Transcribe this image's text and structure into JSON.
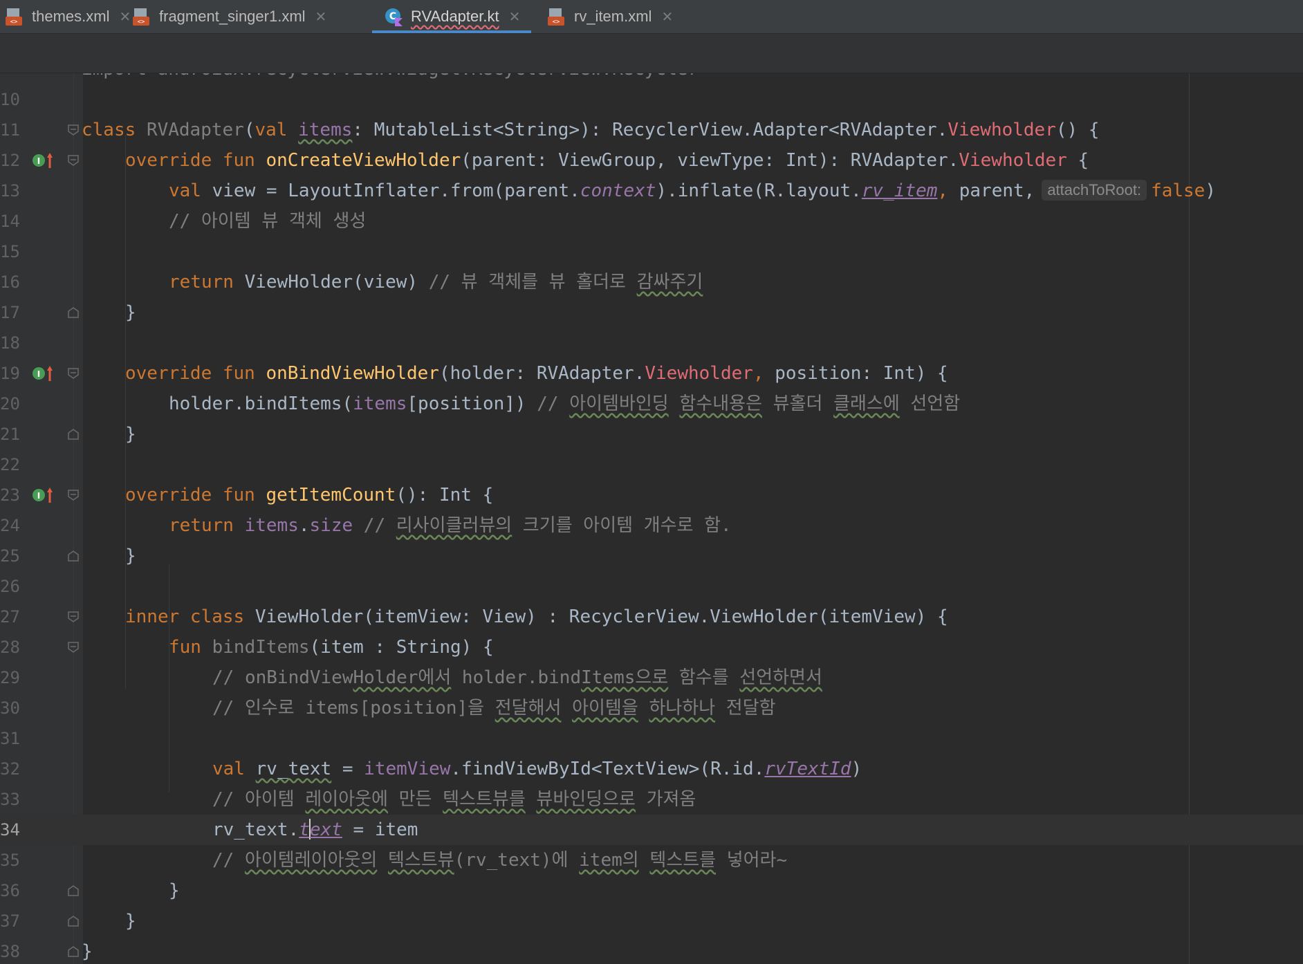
{
  "tabs": [
    {
      "label": "themes.xml",
      "icon": "xml-file-icon",
      "active": false
    },
    {
      "label": "fragment_singer1.xml",
      "icon": "xml-file-icon",
      "active": false
    },
    {
      "label": "RVAdapter.kt",
      "icon": "kotlin-class-icon",
      "active": true
    },
    {
      "label": "rv_item.xml",
      "icon": "xml-file-icon",
      "active": false
    }
  ],
  "editor": {
    "current_line": "34",
    "partial_top_line": "import androidx.recyclerview.widget.RecyclerView.Recycler",
    "line_numbers": [
      "10",
      "11",
      "12",
      "13",
      "14",
      "15",
      "16",
      "17",
      "18",
      "19",
      "20",
      "21",
      "22",
      "23",
      "24",
      "25",
      "26",
      "27",
      "28",
      "29",
      "30",
      "31",
      "32",
      "33",
      "34",
      "35",
      "36",
      "37",
      "38"
    ],
    "lines": {
      "l11": {
        "kw_class": "class",
        "name": "RVAdapter",
        "p1": "(",
        "kw_val": "val",
        "items": "items",
        "sig": ": MutableList<String>): RecyclerView.Adapter<RVAdapter.",
        "vh": "Viewholder",
        "end": "() {"
      },
      "l12": {
        "kw": "override fun",
        "fn": "onCreateViewHolder",
        "rest": "(parent: ViewGroup, viewType: Int): RVAdapter.",
        "vh": "Viewholder",
        "end": " {"
      },
      "l13": {
        "kw": "val",
        "a": " view = LayoutInflater.from(parent.",
        "ctx": "context",
        "b": ").inflate(R.layout.",
        "rv": "rv_item",
        "comma": ",",
        "c": " parent,",
        "hint": "attachToRoot:",
        "false": "false",
        "end": ")"
      },
      "l14": {
        "text": "// 아이템 뷰 객체 생성"
      },
      "l16": {
        "kw": "return",
        "code": " ViewHolder(view) ",
        "c1": "// 뷰 객체를 뷰 홀더로 ",
        "c2": "감싸주기"
      },
      "l17": {
        "text": "}"
      },
      "l19": {
        "kw": "override fun",
        "fn": "onBindViewHolder",
        "a": "(holder: RVAdapter.",
        "vh": "Viewholder",
        "comma": ",",
        "b": " position: Int) {"
      },
      "l20": {
        "a": "holder.bindItems(",
        "items": "items",
        "b": "[position]) ",
        "c1": "// ",
        "c2": "아이템바인딩",
        "c3": " ",
        "c4": "함수내용은",
        "c5": " 뷰홀더 ",
        "c6": "클래스에",
        "c7": " 선언함"
      },
      "l21": {
        "text": "}"
      },
      "l23": {
        "kw": "override fun",
        "fn": "getItemCount",
        "rest": "(): Int {"
      },
      "l24": {
        "kw": "return",
        "items": "items",
        "dot": ".",
        "size": "size",
        "c1": "// ",
        "c2": "리사이클러뷰의",
        "c3": " 크기를 아이템 개수로 함."
      },
      "l25": {
        "text": "}"
      },
      "l27": {
        "kw": "inner class",
        "rest": " ViewHolder(itemView: View) : RecyclerView.ViewHolder(itemView) {"
      },
      "l28": {
        "kw": "fun",
        "fn": "bindItems",
        "rest": "(item : String) {"
      },
      "l29": {
        "c1": "// onBindView",
        "c2": "Holder에서",
        "c3": " holder.bind",
        "c4": "Items으로",
        "c5": " 함수를 ",
        "c6": "선언하면서"
      },
      "l30": {
        "c1": "// 인수로 items[position]을 ",
        "c2": "전달해서",
        "c3": " ",
        "c4": "아이템을",
        "c5": " ",
        "c6": "하나하나",
        "c7": " 전달함"
      },
      "l32": {
        "kw": "val",
        "var": "rv_text",
        "a": " = ",
        "iv": "itemView",
        "b": ".findViewById<TextView>(R.id.",
        "id": "rvTextId",
        "end": ")"
      },
      "l33": {
        "c1": "// 아이템 ",
        "c2": "레이아웃에",
        "c3": " 만든 ",
        "c4": "텍스트뷰를",
        "c5": " ",
        "c6": "뷰바인딩으로",
        "c7": " 가져옴"
      },
      "l34": {
        "a": "rv_text.",
        "t1": "t",
        "t2": "ext",
        "b": " = item"
      },
      "l35": {
        "c1": "// ",
        "c2": "아이템레이아웃의",
        "c3": " ",
        "c4": "텍스트뷰",
        "c5": "(rv_text)에 ",
        "c6": "item의",
        "c7": " ",
        "c8": "텍스트를",
        "c9": " 넣어라~"
      },
      "l36": {
        "text": "}"
      },
      "l37": {
        "text": "}"
      },
      "l38": {
        "text": "}"
      }
    }
  },
  "colors": {
    "background": "#2b2b2b",
    "keyword": "#cc7832",
    "function": "#ffc66d",
    "comment": "#808080",
    "property": "#9876aa",
    "error": "#e06c75",
    "text": "#a9b7c6",
    "active_tab_underline": "#4a88c7"
  }
}
